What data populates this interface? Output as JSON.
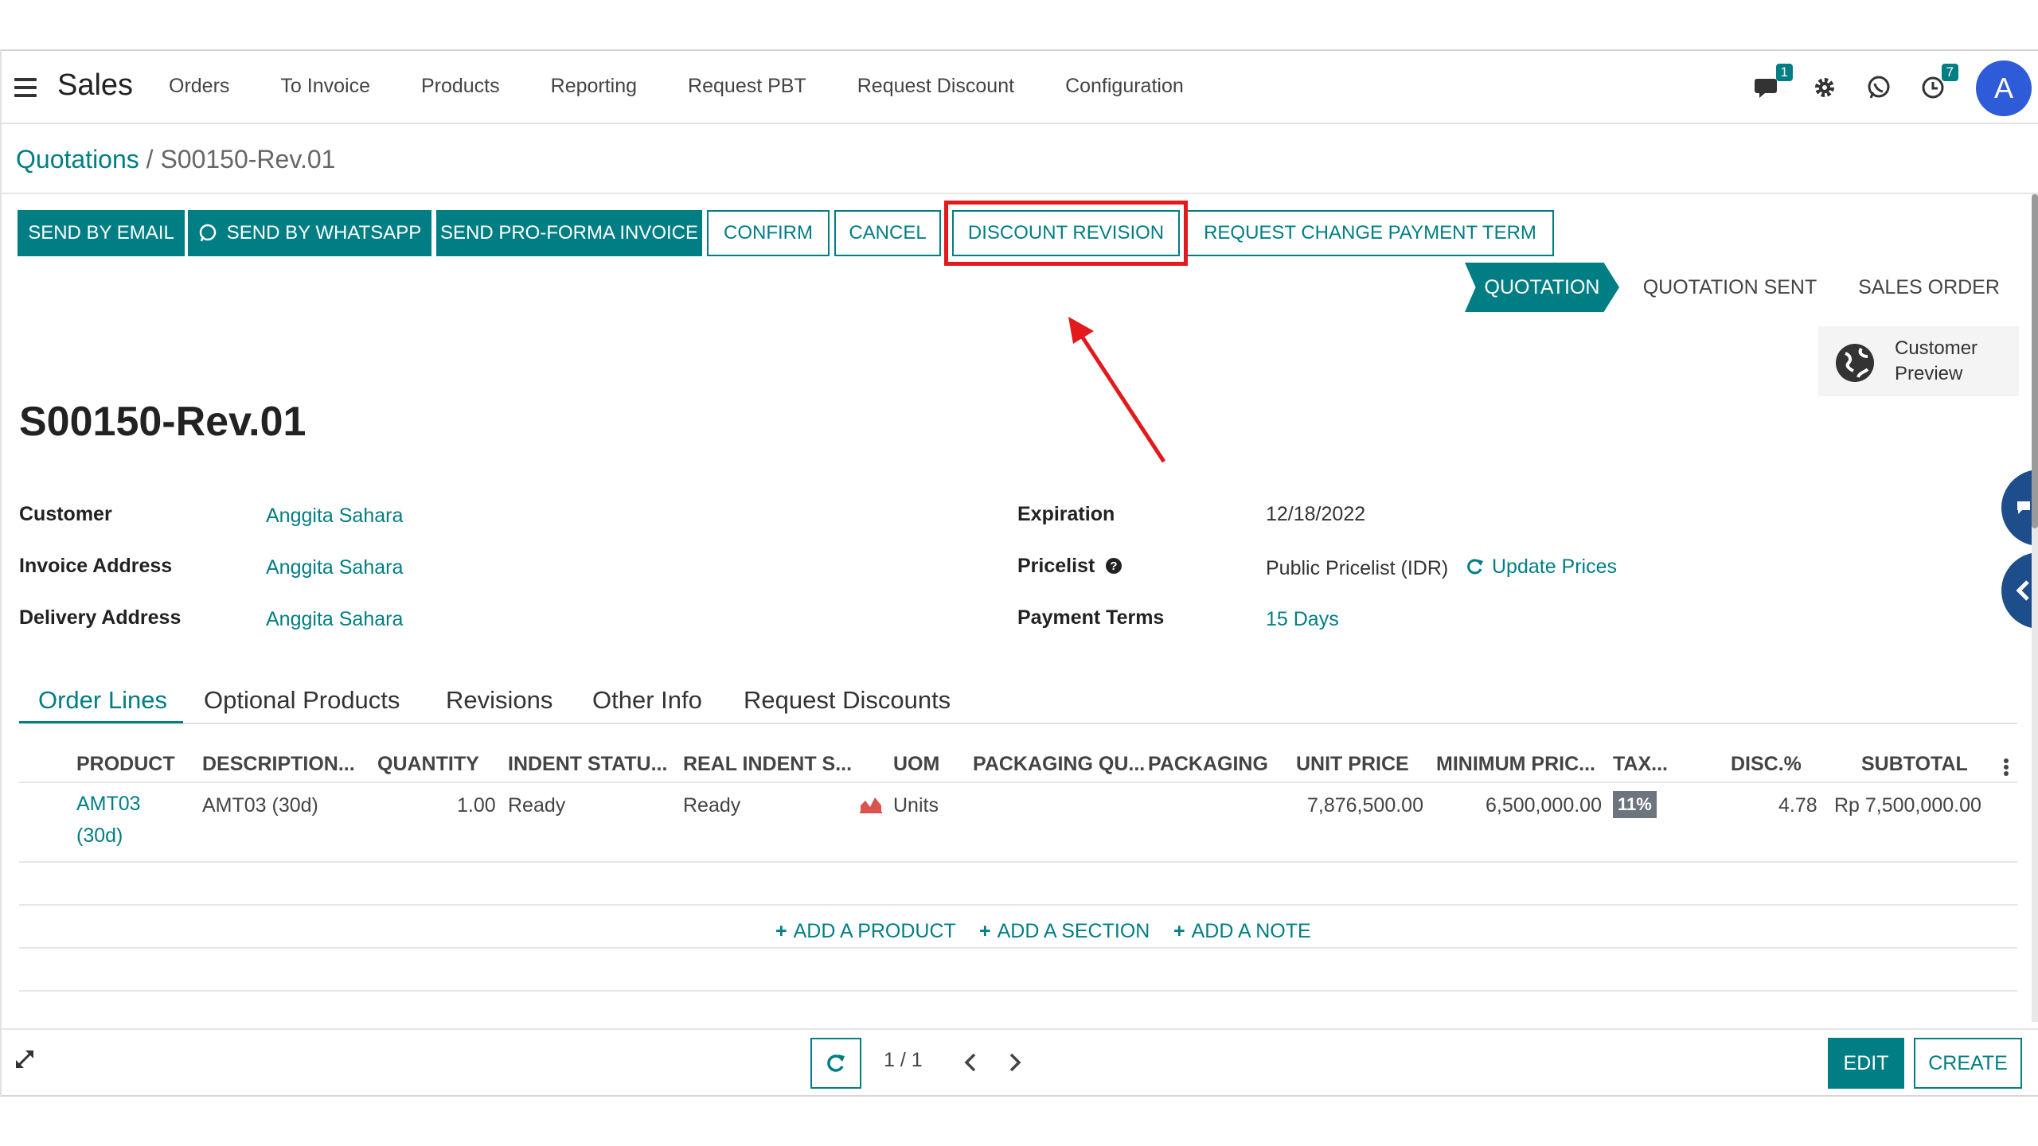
{
  "app": {
    "name": "Sales"
  },
  "menu": [
    "Orders",
    "To Invoice",
    "Products",
    "Reporting",
    "Request PBT",
    "Request Discount",
    "Configuration"
  ],
  "systray": {
    "messages_count": "1",
    "activities_count": "7",
    "avatar_letter": "A"
  },
  "breadcrumb": {
    "parent": "Quotations",
    "separator": " / ",
    "current": "S00150-Rev.01"
  },
  "actions": {
    "send_email": "SEND BY EMAIL",
    "send_whatsapp": "SEND BY WHATSAPP",
    "send_proforma": "SEND PRO-FORMA INVOICE",
    "confirm": "CONFIRM",
    "cancel": "CANCEL",
    "discount_revision": "DISCOUNT REVISION",
    "change_payment_term": "REQUEST CHANGE PAYMENT TERM"
  },
  "status": {
    "quotation": "QUOTATION",
    "sent": "QUOTATION SENT",
    "sales_order": "SALES ORDER"
  },
  "customer_preview": {
    "line1": "Customer",
    "line2": "Preview"
  },
  "record_title": "S00150-Rev.01",
  "fields": {
    "customer_label": "Customer",
    "customer_value": "Anggita Sahara",
    "invoice_label": "Invoice Address",
    "invoice_value": "Anggita Sahara",
    "delivery_label": "Delivery Address",
    "delivery_value": "Anggita Sahara",
    "expiration_label": "Expiration",
    "expiration_value": "12/18/2022",
    "pricelist_label": "Pricelist",
    "pricelist_value": "Public Pricelist (IDR)",
    "update_prices": "Update Prices",
    "payment_label": "Payment Terms",
    "payment_value": "15 Days"
  },
  "tabs": [
    "Order Lines",
    "Optional Products",
    "Revisions",
    "Other Info",
    "Request Discounts"
  ],
  "table": {
    "headers": [
      "PRODUCT",
      "DESCRIPTION...",
      "QUANTITY",
      "INDENT STATU...",
      "REAL INDENT S...",
      "UOM",
      "PACKAGING QU...",
      "PACKAGING",
      "UNIT PRICE",
      "MINIMUM PRIC...",
      "TAX...",
      "DISC.%",
      "SUBTOTAL"
    ],
    "row": {
      "product_line1": "AMT03",
      "product_line2": "(30d)",
      "description": "AMT03 (30d)",
      "quantity": "1.00",
      "indent_status": "Ready",
      "real_indent": "Ready",
      "uom": "Units",
      "unit_price": "7,876,500.00",
      "min_price": "6,500,000.00",
      "tax": "11%",
      "disc": "4.78",
      "subtotal": "Rp 7,500,000.00"
    },
    "add_product": "ADD A PRODUCT",
    "add_section": "ADD A SECTION",
    "add_note": "ADD A NOTE"
  },
  "pager": {
    "value": "1 / 1"
  },
  "footer": {
    "edit": "EDIT",
    "create": "CREATE"
  },
  "colors": {
    "accent": "#017e84",
    "highlight": "#e3191c"
  }
}
